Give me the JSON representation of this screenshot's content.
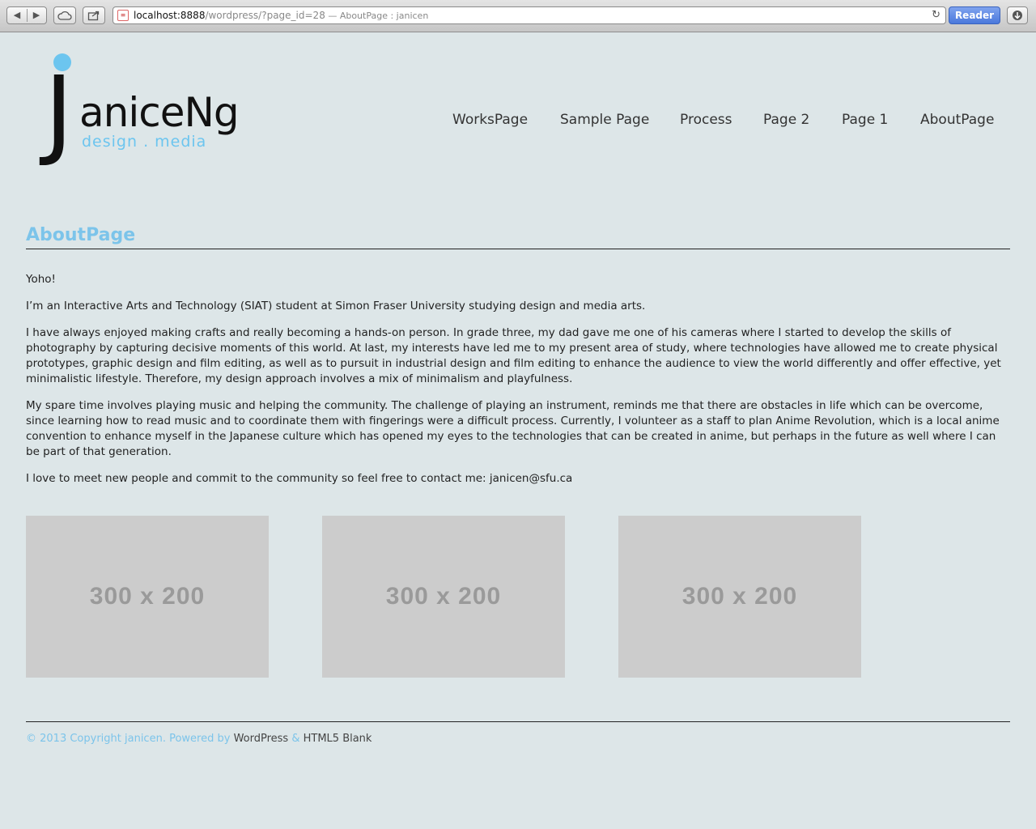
{
  "browser": {
    "url_host": "localhost:8888",
    "url_path": "/wordpress/?page_id=28",
    "page_title": " — AboutPage : janicen",
    "reader_label": "Reader",
    "back_label": "◀",
    "forward_label": "▶",
    "reload_label": "↻",
    "favicon_label": "≡"
  },
  "logo": {
    "letter": "J",
    "name": "aniceNg",
    "tagline": "design . media"
  },
  "nav": {
    "items": [
      "WorksPage",
      "Sample Page",
      "Process",
      "Page 2",
      "Page 1",
      "AboutPage"
    ]
  },
  "page": {
    "title": "AboutPage",
    "paragraphs": [
      "Yoho!",
      "I’m an Interactive Arts and Technology (SIAT) student at Simon Fraser University studying design and media arts.",
      "I have always enjoyed making crafts and really becoming a hands-on person. In grade three, my dad gave me one of his cameras where I started to develop the skills of photography by capturing decisive moments of this world. At last, my interests have led me to my present area of study, where technologies have allowed me to create physical prototypes, graphic design and film editing, as well as to pursuit in industrial design and film editing to enhance the audience to view the world differently and offer effective, yet minimalistic lifestyle. Therefore, my design approach involves a mix of minimalism and playfulness.",
      "My spare time involves playing music and helping the community. The challenge of playing an instrument, reminds me that there are obstacles in life which can be overcome, since learning how to read music and to coordinate them with fingerings were a difficult process. Currently, I volunteer as a staff to plan Anime Revolution, which is a local anime convention to enhance myself in the Japanese culture which has opened my eyes to the technologies that can be created in anime, but perhaps in the future as well where I can be part of that generation.",
      "I love to meet new people and commit to the community so feel free to contact me: janicen@sfu.ca"
    ],
    "placeholders": [
      "300 x 200",
      "300 x 200",
      "300 x 200"
    ]
  },
  "footer": {
    "copyright": "© 2013 Copyright janicen. Powered by ",
    "wordpress": "WordPress",
    "amp": " & ",
    "html5blank": "HTML5 Blank"
  },
  "colors": {
    "background": "#dde6e8",
    "accent": "#7cc4ea",
    "placeholder": "#cccccc"
  }
}
